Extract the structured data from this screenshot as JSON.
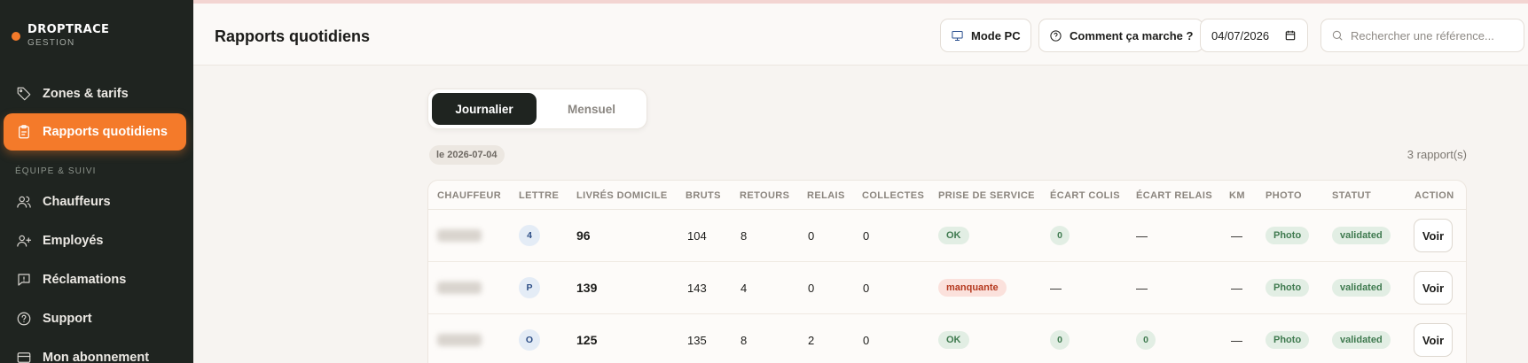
{
  "brand": {
    "name": "DROPTRACE",
    "subtitle": "GESTION"
  },
  "sidebar": {
    "items": [
      {
        "label": "Zones & tarifs",
        "icon": "tag-icon"
      },
      {
        "label": "Rapports quotidiens",
        "icon": "clipboard-icon",
        "active": true
      },
      {
        "label": "Chauffeurs",
        "icon": "users-icon"
      },
      {
        "label": "Employés",
        "icon": "user-plus-icon"
      },
      {
        "label": "Réclamations",
        "icon": "message-icon"
      },
      {
        "label": "Support",
        "icon": "help-circle-icon"
      },
      {
        "label": "Mon abonnement",
        "icon": "credit-card-icon"
      }
    ],
    "section_label": "ÉQUIPE & SUIVI"
  },
  "header": {
    "title": "Rapports quotidiens",
    "mode_pc": "Mode PC",
    "how_it_works": "Comment ça marche ?",
    "date": "04/07/2026",
    "search_placeholder": "Rechercher une référence..."
  },
  "main": {
    "tabs": [
      {
        "label": "Journalier",
        "active": true
      },
      {
        "label": "Mensuel",
        "active": false
      }
    ],
    "date_chip": "le 2026-07-04",
    "report_count": "3 rapport(s)"
  },
  "table": {
    "columns": [
      "CHAUFFEUR",
      "LETTRE",
      "LIVRÉS DOMICILE",
      "BRUTS",
      "RETOURS",
      "RELAIS",
      "COLLECTES",
      "PRISE DE SERVICE",
      "ÉCART COLIS",
      "ÉCART RELAIS",
      "KM",
      "PHOTO",
      "STATUT",
      "ACTION"
    ],
    "rows": [
      {
        "lettre": "4",
        "livres": "96",
        "bruts": "104",
        "retours": "8",
        "relais": "0",
        "collectes": "0",
        "prise": "OK",
        "prise_status": "ok",
        "ecart_colis": "0",
        "ecart_relais": "—",
        "km": "—",
        "photo": "Photo",
        "statut": "validated",
        "action": "Voir"
      },
      {
        "lettre": "P",
        "livres": "139",
        "bruts": "143",
        "retours": "4",
        "relais": "0",
        "collectes": "0",
        "prise": "manquante",
        "prise_status": "missing",
        "ecart_colis": "—",
        "ecart_relais": "—",
        "km": "—",
        "photo": "Photo",
        "statut": "validated",
        "action": "Voir"
      },
      {
        "lettre": "O",
        "livres": "125",
        "bruts": "135",
        "retours": "8",
        "relais": "2",
        "collectes": "0",
        "prise": "OK",
        "prise_status": "ok",
        "ecart_colis": "0",
        "ecart_relais": "0",
        "km": "—",
        "photo": "Photo",
        "statut": "validated",
        "action": "Voir"
      }
    ]
  },
  "colors": {
    "accent": "#f47a2a",
    "sidebar_bg": "#1f2420",
    "ok_green": "#3f7a4f",
    "missing_red": "#b5391f"
  }
}
